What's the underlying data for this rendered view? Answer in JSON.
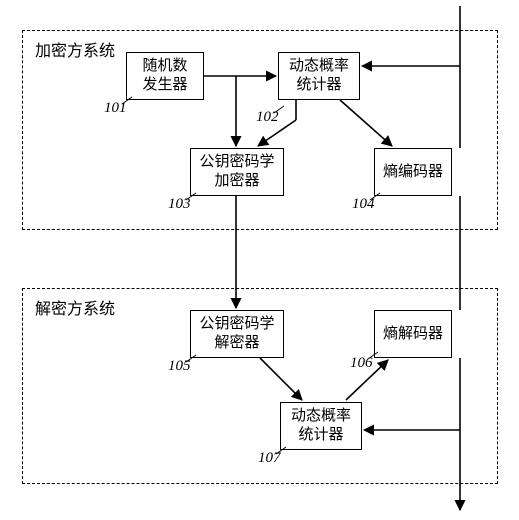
{
  "groups": {
    "enc": {
      "label": "加密方系统"
    },
    "dec": {
      "label": "解密方系统"
    }
  },
  "nodes": {
    "n101": {
      "label": "随机数\n发生器",
      "ref": "101"
    },
    "n102": {
      "label": "动态概率\n统计器",
      "ref": "102"
    },
    "n103": {
      "label": "公钥密码学\n加密器",
      "ref": "103"
    },
    "n104": {
      "label": "熵编码器",
      "ref": "104"
    },
    "n105": {
      "label": "公钥密码学\n解密器",
      "ref": "105"
    },
    "n106": {
      "label": "熵解码器",
      "ref": "106"
    },
    "n107": {
      "label": "动态概率\n统计器",
      "ref": "107"
    }
  },
  "chart_data": {
    "type": "diagram",
    "title": "",
    "groups": [
      {
        "id": "enc",
        "label": "加密方系统",
        "contains": [
          "101",
          "102",
          "103",
          "104"
        ]
      },
      {
        "id": "dec",
        "label": "解密方系统",
        "contains": [
          "105",
          "106",
          "107"
        ]
      }
    ],
    "nodes": [
      {
        "id": "101",
        "label": "随机数发生器"
      },
      {
        "id": "102",
        "label": "动态概率统计器"
      },
      {
        "id": "103",
        "label": "公钥密码学加密器"
      },
      {
        "id": "104",
        "label": "熵编码器"
      },
      {
        "id": "105",
        "label": "公钥密码学解密器"
      },
      {
        "id": "106",
        "label": "熵解码器"
      },
      {
        "id": "107",
        "label": "动态概率统计器"
      },
      {
        "id": "bus_in",
        "label": ""
      },
      {
        "id": "bus_out",
        "label": ""
      }
    ],
    "edges": [
      {
        "from": "101",
        "to": "102"
      },
      {
        "from": "101",
        "to": "103"
      },
      {
        "from": "102",
        "to": "103"
      },
      {
        "from": "102",
        "to": "104"
      },
      {
        "from": "bus_in",
        "to": "102"
      },
      {
        "from": "bus_in",
        "to": "104"
      },
      {
        "from": "103",
        "to": "105"
      },
      {
        "from": "104",
        "to": "106"
      },
      {
        "from": "105",
        "to": "107"
      },
      {
        "from": "107",
        "to": "106"
      },
      {
        "from": "bus_in",
        "to": "107"
      },
      {
        "from": "106",
        "to": "bus_out"
      }
    ]
  }
}
